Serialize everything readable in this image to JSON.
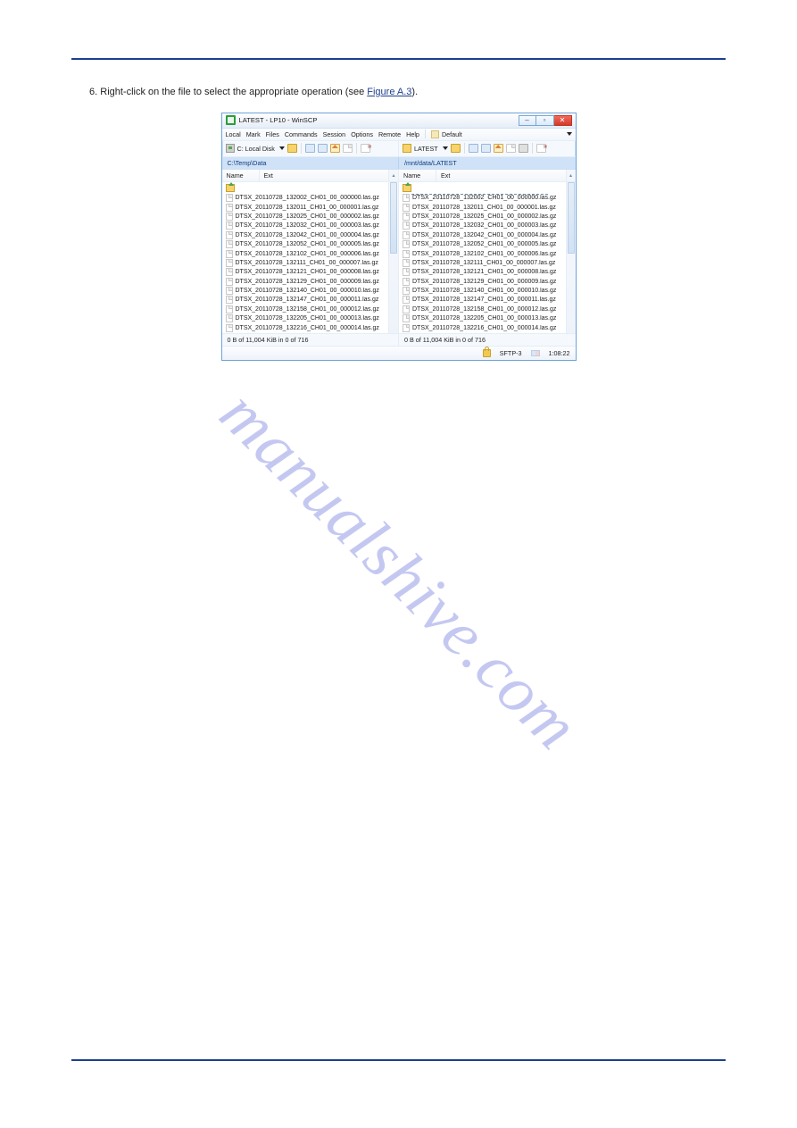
{
  "watermark_text": "manualshive.com",
  "intro": {
    "prefix": "6.",
    "body": "Right-click on the file to select the appropriate operation (see",
    "figref": "Figure A.3",
    "tail": ")."
  },
  "win": {
    "title": "LATEST - LP10 - WinSCP",
    "menu": [
      "Local",
      "Mark",
      "Files",
      "Commands",
      "Session",
      "Options",
      "Remote",
      "Help"
    ],
    "default_label": "Default",
    "left": {
      "disk": "C: Local Disk",
      "path": "C:\\Temp\\Data",
      "cols": [
        "Name",
        "Ext"
      ],
      "status": "0 B of 11,004 KiB in 0 of 716",
      "files": [
        "DTSX_20110728_132002_CH01_00_000000.las.gz",
        "DTSX_20110728_132011_CH01_00_000001.las.gz",
        "DTSX_20110728_132025_CH01_00_000002.las.gz",
        "DTSX_20110728_132032_CH01_00_000003.las.gz",
        "DTSX_20110728_132042_CH01_00_000004.las.gz",
        "DTSX_20110728_132052_CH01_00_000005.las.gz",
        "DTSX_20110728_132102_CH01_00_000006.las.gz",
        "DTSX_20110728_132111_CH01_00_000007.las.gz",
        "DTSX_20110728_132121_CH01_00_000008.las.gz",
        "DTSX_20110728_132129_CH01_00_000009.las.gz",
        "DTSX_20110728_132140_CH01_00_000010.las.gz",
        "DTSX_20110728_132147_CH01_00_000011.las.gz",
        "DTSX_20110728_132158_CH01_00_000012.las.gz",
        "DTSX_20110728_132205_CH01_00_000013.las.gz",
        "DTSX_20110728_132216_CH01_00_000014.las.gz"
      ]
    },
    "right": {
      "disk": "LATEST",
      "path": "/mnt/data/LATEST",
      "cols": [
        "Name",
        "Ext"
      ],
      "status": "0 B of 11,004 KiB in 0 of 716",
      "updir_selected": true,
      "files": [
        "DTSX_20110728_132002_CH01_00_000000.las.gz",
        "DTSX_20110728_132011_CH01_00_000001.las.gz",
        "DTSX_20110728_132025_CH01_00_000002.las.gz",
        "DTSX_20110728_132032_CH01_00_000003.las.gz",
        "DTSX_20110728_132042_CH01_00_000004.las.gz",
        "DTSX_20110728_132052_CH01_00_000005.las.gz",
        "DTSX_20110728_132102_CH01_00_000006.las.gz",
        "DTSX_20110728_132111_CH01_00_000007.las.gz",
        "DTSX_20110728_132121_CH01_00_000008.las.gz",
        "DTSX_20110728_132129_CH01_00_000009.las.gz",
        "DTSX_20110728_132140_CH01_00_000010.las.gz",
        "DTSX_20110728_132147_CH01_00_000011.las.gz",
        "DTSX_20110728_132158_CH01_00_000012.las.gz",
        "DTSX_20110728_132205_CH01_00_000013.las.gz",
        "DTSX_20110728_132216_CH01_00_000014.las.gz"
      ]
    },
    "footer": {
      "protocol": "SFTP-3",
      "time": "1:08:22"
    }
  }
}
